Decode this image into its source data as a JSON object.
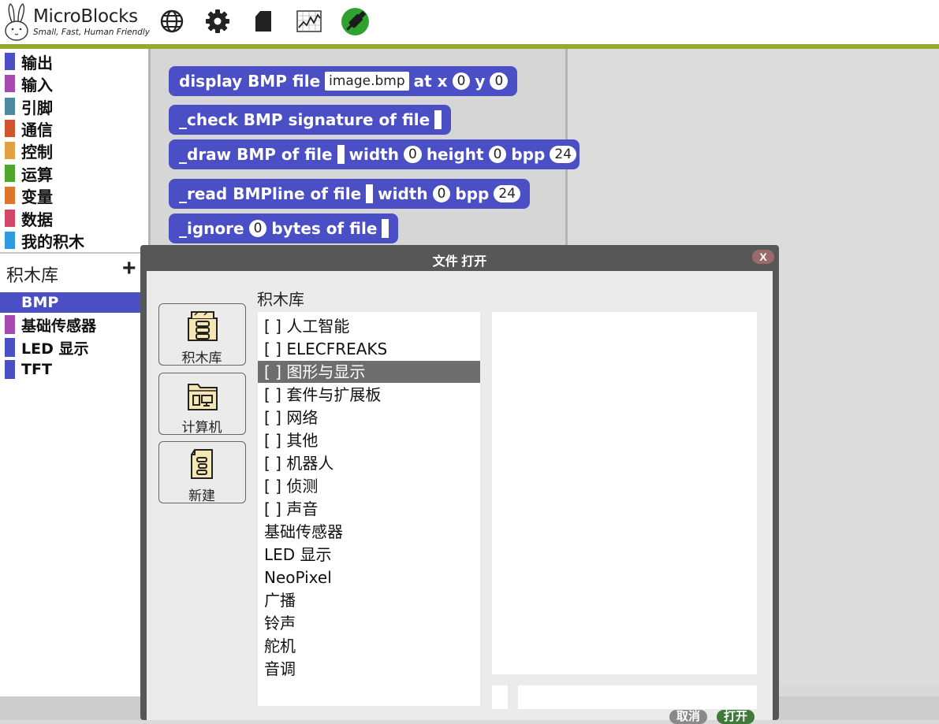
{
  "app": {
    "name": "MicroBlocks",
    "tagline": "Small, Fast, Human Friendly"
  },
  "toolbar": {
    "icons": [
      "globe-icon",
      "gear-icon",
      "file-icon",
      "graph-icon",
      "usb-connected-icon"
    ],
    "connected_color": "#2fa12f"
  },
  "palette": {
    "categories": [
      {
        "label": "输出",
        "color": "#4a4fc6"
      },
      {
        "label": "输入",
        "color": "#a64ab0"
      },
      {
        "label": "引脚",
        "color": "#4b8aa0"
      },
      {
        "label": "通信",
        "color": "#d2542e"
      },
      {
        "label": "控制",
        "color": "#e3a040"
      },
      {
        "label": "运算",
        "color": "#4da82b"
      },
      {
        "label": "变量",
        "color": "#e0742a"
      },
      {
        "label": "数据",
        "color": "#d44668"
      },
      {
        "label": "我的积木",
        "color": "#2d9be0"
      }
    ]
  },
  "libraries": {
    "header": "积木库",
    "add_label": "+",
    "items": [
      {
        "label": "BMP",
        "color": "#4a4fc6",
        "selected": true
      },
      {
        "label": "基础传感器",
        "color": "#a64ab0",
        "selected": false
      },
      {
        "label": "LED 显示",
        "color": "#4a4fc6",
        "selected": false
      },
      {
        "label": "TFT",
        "color": "#4a4fc6",
        "selected": false
      }
    ]
  },
  "blocks": {
    "b1": {
      "text1": "display BMP file",
      "file": "image.bmp",
      "text2": "at x",
      "x": "0",
      "text3": "y",
      "y": "0"
    },
    "b2": {
      "text1": "_check BMP signature of file"
    },
    "b3": {
      "text1": "_draw BMP of file",
      "text2": "width",
      "w": "0",
      "text3": "height",
      "h": "0",
      "text4": "bpp",
      "bpp": "24"
    },
    "b4": {
      "text1": "_read BMPline of file",
      "text2": "width",
      "w": "0",
      "text3": "bpp",
      "bpp": "24"
    },
    "b5": {
      "text1": "_ignore",
      "n": "0",
      "text2": "bytes of file"
    }
  },
  "dialog": {
    "title": "文件 打开",
    "close_label": "X",
    "section_title": "积木库",
    "side_buttons": [
      {
        "label": "积木库"
      },
      {
        "label": "计算机"
      },
      {
        "label": "新建"
      }
    ],
    "files": [
      "[ ] 人工智能",
      "[ ] ELECFREAKS",
      "[ ] 图形与显示",
      "[ ] 套件与扩展板",
      "[ ] 网络",
      "[ ] 其他",
      "[ ] 机器人",
      "[ ] 侦测",
      "[ ] 声音",
      "基础传感器",
      "LED 显示",
      "NeoPixel",
      "广播",
      "铃声",
      "舵机",
      "音调"
    ],
    "selected_index": 2,
    "cancel_label": "取消",
    "open_label": "打开"
  }
}
